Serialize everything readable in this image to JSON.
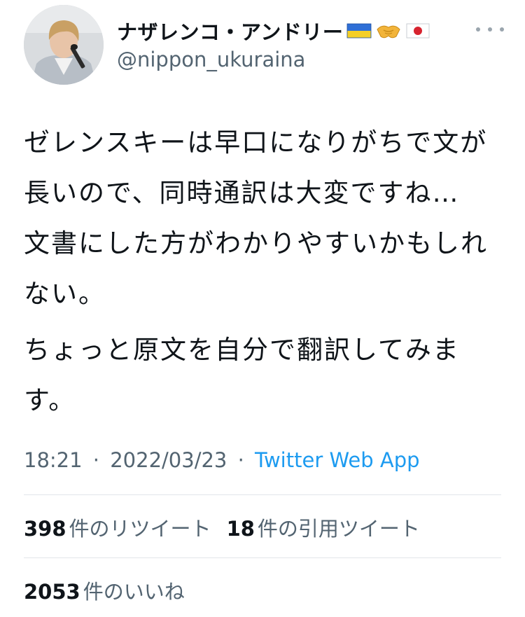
{
  "author": {
    "display_name": "ナザレンコ・アンドリー",
    "emojis": [
      "ukraine-flag-icon",
      "handshake-icon",
      "japan-flag-icon"
    ],
    "handle": "@nippon_ukuraina"
  },
  "tweet": {
    "paragraphs": [
      "ゼレンスキーは早口になりがちで文が長いので、同時通訳は大変ですね…　文書にした方がわかりやすいかもしれない。",
      "ちょっと原文を自分で翻訳してみます。"
    ],
    "time": "18:21",
    "date": "2022/03/23",
    "separator": "·",
    "source": "Twitter Web App"
  },
  "stats": {
    "retweets": {
      "count": "398",
      "label": "件のリツイート"
    },
    "quotes": {
      "count": "18",
      "label": "件の引用ツイート"
    },
    "likes": {
      "count": "2053",
      "label": "件のいいね"
    }
  },
  "colors": {
    "text": "#0f1419",
    "secondary": "#536471",
    "link": "#1d9bf0",
    "divider": "#e2e6ea"
  }
}
